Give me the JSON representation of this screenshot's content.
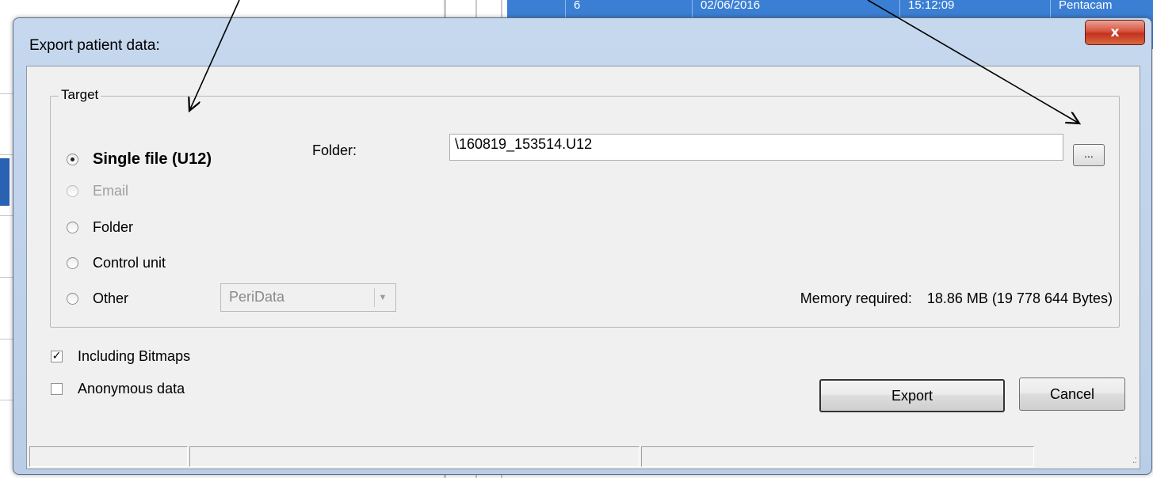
{
  "background": {
    "table_row": {
      "col1": "6",
      "col2": "02/06/2016",
      "col3": "15:12:09",
      "col4": "Pentacam"
    }
  },
  "dialog": {
    "title": "Export patient data:",
    "close_glyph": "x",
    "target_group": {
      "legend": "Target",
      "options": [
        {
          "label": "Single file (U12)",
          "selected": true,
          "enabled": true
        },
        {
          "label": "Email",
          "selected": false,
          "enabled": false
        },
        {
          "label": "Folder",
          "selected": false,
          "enabled": true
        },
        {
          "label": "Control unit",
          "selected": false,
          "enabled": true
        },
        {
          "label": "Other",
          "selected": false,
          "enabled": true
        }
      ],
      "folder_label": "Folder:",
      "folder_value": "\\160819_153514.U12",
      "browse_label": "...",
      "other_select_value": "PeriData",
      "memory_label": "Memory required:",
      "memory_value": "18.86 MB (19 778 644 Bytes)"
    },
    "checkboxes": [
      {
        "label": "Including Bitmaps",
        "checked": true
      },
      {
        "label": "Anonymous data",
        "checked": false
      }
    ],
    "buttons": {
      "export": "Export",
      "cancel": "Cancel"
    }
  },
  "icons": {
    "close": "close-icon",
    "dropdown": "chevron-down-icon",
    "resize_grip": "resize-grip-icon"
  },
  "colors": {
    "dialog_frame": "#c6d8ee",
    "close_button": "#c2321e",
    "table_highlight": "#3b7fd4",
    "client_area": "#f0f0f0"
  }
}
